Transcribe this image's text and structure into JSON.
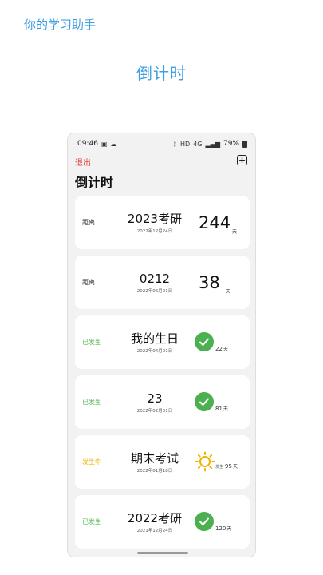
{
  "app_name": "你的学习助手",
  "promo_title": "倒计时",
  "status_bar": {
    "time": "09:46",
    "battery": "79%",
    "network": "4G",
    "wifi": "HD"
  },
  "header": {
    "logout_label": "退出",
    "add_label": "+",
    "title": "倒计时"
  },
  "cards": [
    {
      "status": "距离",
      "title": "2023考研",
      "date": "2022年12月24日",
      "days": "244",
      "unit": "天"
    },
    {
      "status": "距离",
      "title": "0212",
      "date": "2022年06月01日",
      "days": "38",
      "unit": "天"
    },
    {
      "status": "已发生",
      "title": "我的生日",
      "date": "2022年04月01日",
      "days": "22",
      "unit": "天",
      "icon": "check-icon"
    },
    {
      "status": "已发生",
      "title": "23",
      "date": "2022年02月01日",
      "days": "81",
      "unit": "天",
      "icon": "check-icon"
    },
    {
      "status": "发生中",
      "title": "期末考试",
      "date": "2022年01月18日",
      "prefix": "发生",
      "days": "95",
      "unit": "天",
      "icon": "sun-icon"
    },
    {
      "status": "已发生",
      "title": "2022考研",
      "date": "2021年12月24日",
      "days": "120",
      "unit": "天",
      "icon": "check-icon"
    }
  ],
  "colors": {
    "brand": "#3f9fe3",
    "logout": "#e0453a",
    "past": "#5cb85c",
    "ongoing": "#f0b400",
    "check": "#4caf50"
  }
}
